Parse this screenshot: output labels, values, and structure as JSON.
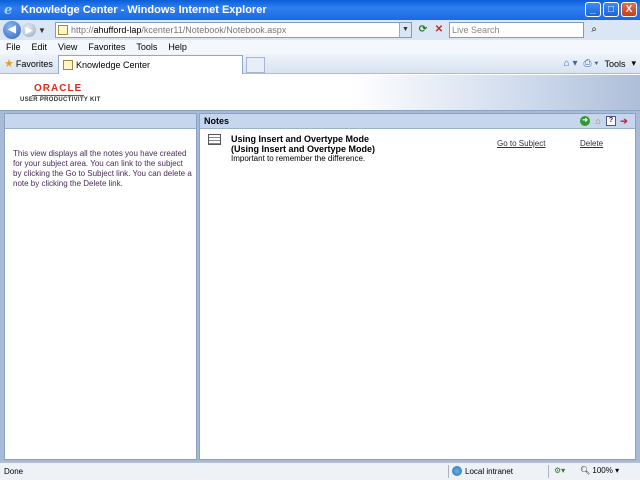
{
  "window": {
    "title": "Knowledge Center - Windows Internet Explorer",
    "buttons": [
      "_",
      "□",
      "X"
    ]
  },
  "addressbar": {
    "url_prefix": "http://",
    "url_host": "ahufford-lap",
    "url_path": "/kcenter11/Notebook/Notebook.aspx",
    "search_placeholder": "Live Search"
  },
  "menubar": {
    "items": [
      "File",
      "Edit",
      "View",
      "Favorites",
      "Tools",
      "Help"
    ]
  },
  "tabbar": {
    "favorites_label": "Favorites",
    "active_tab": "Knowledge Center",
    "tools_label": "Tools"
  },
  "header": {
    "brand": "ORACLE",
    "product": "USER PRODUCTIVITY KIT"
  },
  "leftpane": {
    "description": "This view displays all the notes you have created for your subject area. You can link to the subject by clicking the Go to Subject link. You can delete a note by clicking the Delete link."
  },
  "notes": {
    "heading": "Notes",
    "items": [
      {
        "title": "Using Insert and Overtype Mode",
        "subject": "(Using Insert and Overtype Mode)",
        "text": "Important to remember the difference.",
        "goto_label": "Go to Subject",
        "delete_label": "Delete"
      }
    ]
  },
  "statusbar": {
    "status": "Done",
    "zone": "Local intranet",
    "zoom": "100%"
  }
}
